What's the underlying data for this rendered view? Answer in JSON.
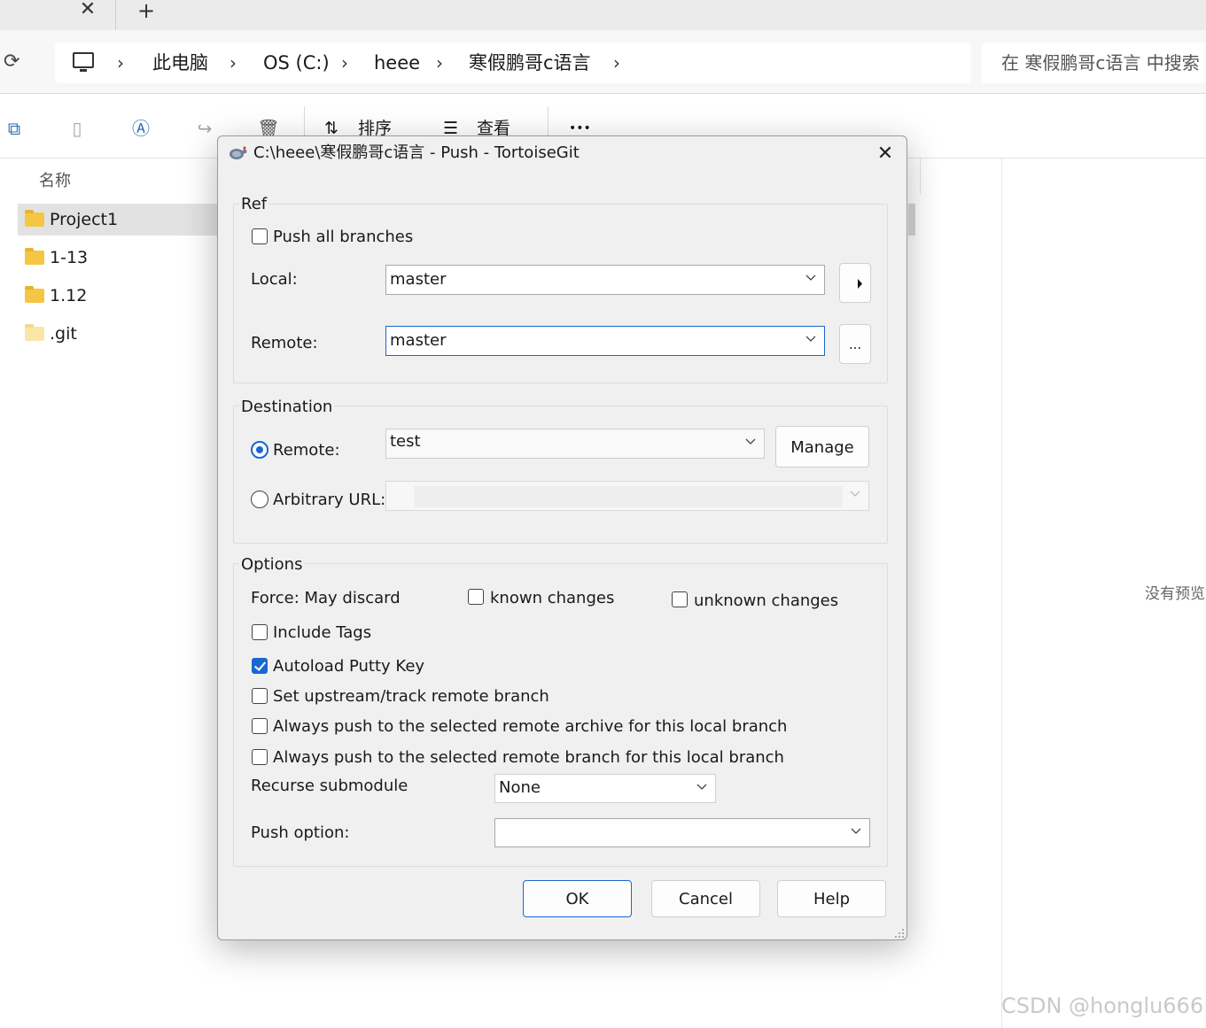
{
  "explorer": {
    "tab_close": "✕",
    "tab_new": "+",
    "breadcrumb": [
      "此电脑",
      "OS (C:)",
      "heee",
      "寒假鹏哥c语言"
    ],
    "search_placeholder": "在 寒假鹏哥c语言 中搜索",
    "toolbar": {
      "sort_label": "排序",
      "view_label": "查看",
      "more_label": "•••"
    },
    "column_header": "名称",
    "files": [
      {
        "name": "Project1",
        "selected": true,
        "hidden": false
      },
      {
        "name": "1-13",
        "selected": false,
        "hidden": false
      },
      {
        "name": "1.12",
        "selected": false,
        "hidden": false
      },
      {
        "name": ".git",
        "selected": false,
        "hidden": true
      }
    ],
    "preview_text": "没有预览",
    "watermark": "CSDN @honglu666"
  },
  "dialog": {
    "title": "C:\\heee\\寒假鹏哥c语言 - Push - TortoiseGit",
    "ref": {
      "group_title": "Ref",
      "push_all_branches": {
        "label": "Push all branches",
        "checked": false
      },
      "local_label": "Local:",
      "local_value": "master",
      "remote_label": "Remote:",
      "remote_value": "master",
      "browse_label": "..."
    },
    "destination": {
      "group_title": "Destination",
      "remote_radio_label": "Remote:",
      "remote_selected": true,
      "remote_value": "test",
      "manage_label": "Manage",
      "arbitrary_url_label": "Arbitrary URL:",
      "arbitrary_url_value": ""
    },
    "options": {
      "group_title": "Options",
      "force_label": "Force: May discard",
      "known_changes": {
        "label": "known changes",
        "checked": false
      },
      "unknown_changes": {
        "label": "unknown changes",
        "checked": false
      },
      "include_tags": {
        "label": "Include Tags",
        "checked": false
      },
      "autoload_putty": {
        "label": "Autoload Putty Key",
        "checked": true
      },
      "set_upstream": {
        "label": "Set upstream/track remote branch",
        "checked": false
      },
      "always_push_archive": {
        "label": "Always push to the selected remote archive for this local branch",
        "checked": false
      },
      "always_push_branch": {
        "label": "Always push to the selected remote branch for this local branch",
        "checked": false
      },
      "recurse_label": "Recurse submodule",
      "recurse_value": "None",
      "push_option_label": "Push option:",
      "push_option_value": ""
    },
    "buttons": {
      "ok": "OK",
      "cancel": "Cancel",
      "help": "Help"
    }
  }
}
